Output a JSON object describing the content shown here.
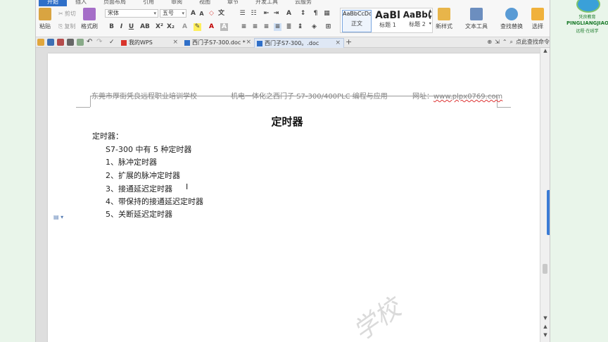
{
  "menu_tabs": [
    "开始",
    "插入",
    "页面布局",
    "引用",
    "审阅",
    "视图",
    "章节",
    "开发工具",
    "云服务"
  ],
  "ribbon": {
    "paste": "粘贴",
    "cut": "剪切",
    "copy": "复制",
    "format_painter": "格式刷",
    "font_name": "宋体",
    "font_size": "五号",
    "styles": [
      {
        "sample": "AaBbCcDd",
        "name": "正文"
      },
      {
        "sample": "AaBl",
        "name": "标题 1"
      },
      {
        "sample": "AaBb(",
        "name": "标题 2"
      }
    ],
    "new_style": "新样式",
    "text_tools": "文本工具",
    "find_replace": "查找替换",
    "select": "选择"
  },
  "tabs": [
    {
      "label": "我的WPS"
    },
    {
      "label": "西门子S7-300.doc *"
    },
    {
      "label": "西门子S7-300。.doc",
      "active": true
    }
  ],
  "command_search": "点此查找命令",
  "document": {
    "header_left": "东莞市厚街凭良远程职业培训学校",
    "header_mid": "机电一体化之西门子 S7-300/400PLC 编程与应用",
    "header_right_label": "网址：",
    "header_url": "www.plpx0769.com",
    "title": "定时器",
    "lines": [
      "定时器：",
      "S7-300 中有 5 种定时器",
      "1、脉冲定时器",
      "2、扩展的脉冲定时器",
      "3、接通延迟定时器",
      "4、带保持的接通延迟定时器",
      "5、关断延迟定时器"
    ],
    "watermark": "学校"
  },
  "logo": {
    "line1": "凭良教育",
    "line2": "PINGLIANGJIAOYU",
    "line3": "远程·在线学"
  }
}
